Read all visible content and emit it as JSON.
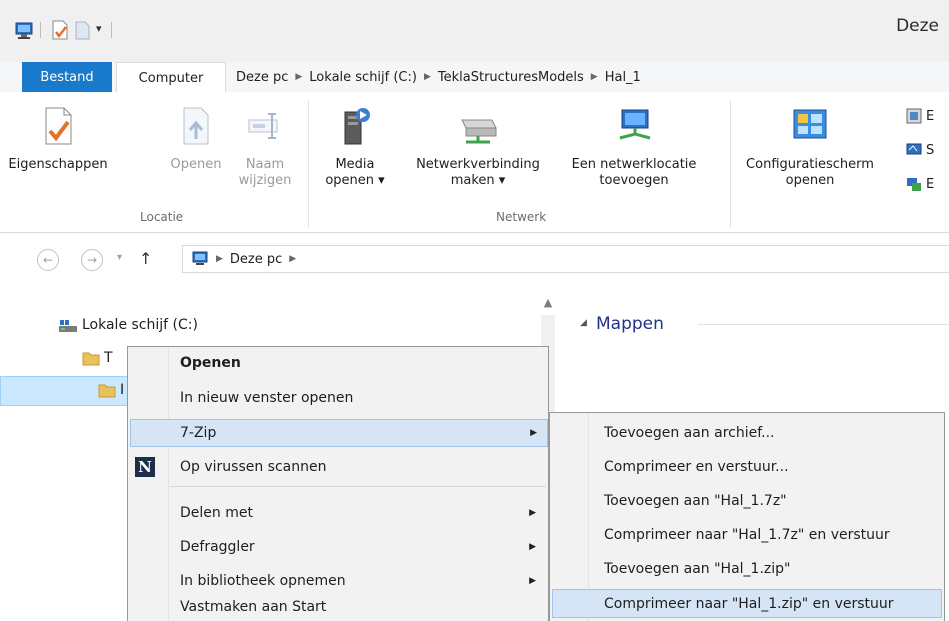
{
  "window": {
    "title": "Deze"
  },
  "ribbon": {
    "tabs": {
      "file": "Bestand",
      "active": "Computer"
    },
    "breadcrumbs": [
      "Deze pc",
      "Lokale schijf (C:)",
      "TeklaStructuresModels",
      "Hal_1"
    ],
    "groups": {
      "locatie": {
        "label": "Locatie",
        "buttons": [
          {
            "label1": "Eigenschappen",
            "label2": "",
            "icon": "properties-icon",
            "enabled": true
          },
          {
            "label1": "Openen",
            "label2": "",
            "icon": "open-icon",
            "enabled": false
          },
          {
            "label1": "Naam",
            "label2": "wijzigen",
            "icon": "rename-icon",
            "enabled": false
          }
        ]
      },
      "netwerk": {
        "label": "Netwerk",
        "buttons": [
          {
            "label1": "Media",
            "label2": "openen ▾",
            "icon": "media-server-icon"
          },
          {
            "label1": "Netwerkverbinding",
            "label2": "maken ▾",
            "icon": "map-network-drive-icon"
          },
          {
            "label1": "Een netwerklocatie",
            "label2": "toevoegen",
            "icon": "network-location-icon"
          }
        ]
      },
      "systeem": {
        "buttons": [
          {
            "label1": "Configuratiescherm",
            "label2": "openen",
            "icon": "control-panel-icon"
          }
        ],
        "small_labels": [
          "E",
          "S",
          "E"
        ]
      }
    }
  },
  "navigation": {
    "back": "←",
    "forward": "→",
    "recent": "▾",
    "up": "↑",
    "address": [
      "Deze pc"
    ]
  },
  "tree": {
    "items": [
      {
        "label": "Lokale schijf (C:)",
        "icon": "drive-icon"
      },
      {
        "label": "T",
        "icon": "folder-icon"
      },
      {
        "label": "I",
        "icon": "folder-icon"
      }
    ]
  },
  "content": {
    "group_header": "Mappen",
    "group_toggle": "◢"
  },
  "context_menu": {
    "items": [
      {
        "label": "Openen",
        "bold": true
      },
      {
        "label": "In nieuw venster openen"
      },
      {
        "label": "7-Zip",
        "submenu": true,
        "hover": true
      },
      {
        "label": "Op virussen scannen",
        "icon": "N"
      },
      {
        "label": "Delen met",
        "submenu": true
      },
      {
        "label": "Defraggler",
        "submenu": true
      },
      {
        "label": "In bibliotheek opnemen",
        "submenu": true
      },
      {
        "label": "Vastmaken aan Start"
      }
    ]
  },
  "submenu_7zip": {
    "items": [
      {
        "label": "Toevoegen aan archief..."
      },
      {
        "label": "Comprimeer en verstuur..."
      },
      {
        "label": "Toevoegen aan \"Hal_1.7z\""
      },
      {
        "label": "Comprimeer naar \"Hal_1.7z\" en verstuur"
      },
      {
        "label": "Toevoegen aan \"Hal_1.zip\""
      },
      {
        "label": "Comprimeer naar \"Hal_1.zip\" en verstuur",
        "hover": true
      }
    ]
  },
  "colors": {
    "accent": "#1979ca",
    "selection": "#cce8ff",
    "menu_hover": "#d5e5f5",
    "header_blue": "#1e3287"
  }
}
